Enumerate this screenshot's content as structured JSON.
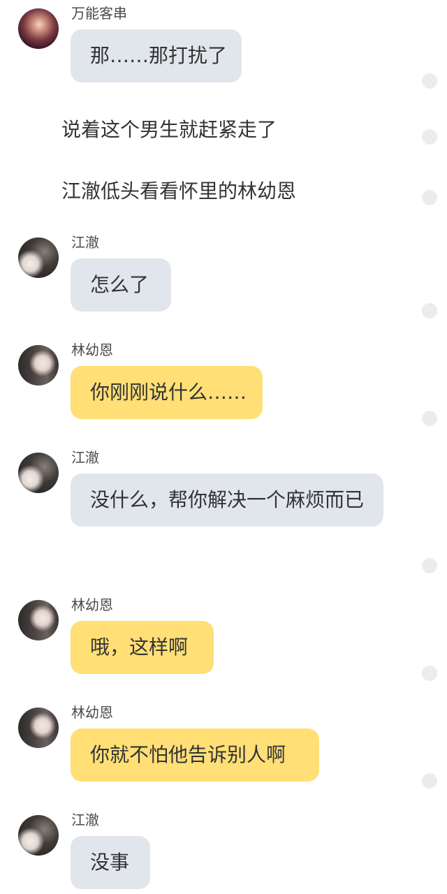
{
  "messages": [
    {
      "speaker": "万能客串",
      "text": "那……那打扰了"
    },
    {
      "speaker": "江澈",
      "text": "怎么了"
    },
    {
      "speaker": "林幼恩",
      "text": "你刚刚说什么……"
    },
    {
      "speaker": "江澈",
      "text": "没什么，帮你解决一个麻烦而已"
    },
    {
      "speaker": "林幼恩",
      "text": "哦，这样啊"
    },
    {
      "speaker": "林幼恩",
      "text": "你就不怕他告诉别人啊"
    },
    {
      "speaker": "江澈",
      "text": "没事"
    }
  ],
  "narration": [
    "说着这个男生就赶紧走了",
    "江澈低头看看怀里的林幼恩"
  ],
  "colors": {
    "bubble_gray": "#e1e5ec",
    "bubble_yellow": "#ffdf76",
    "text": "#333333"
  }
}
